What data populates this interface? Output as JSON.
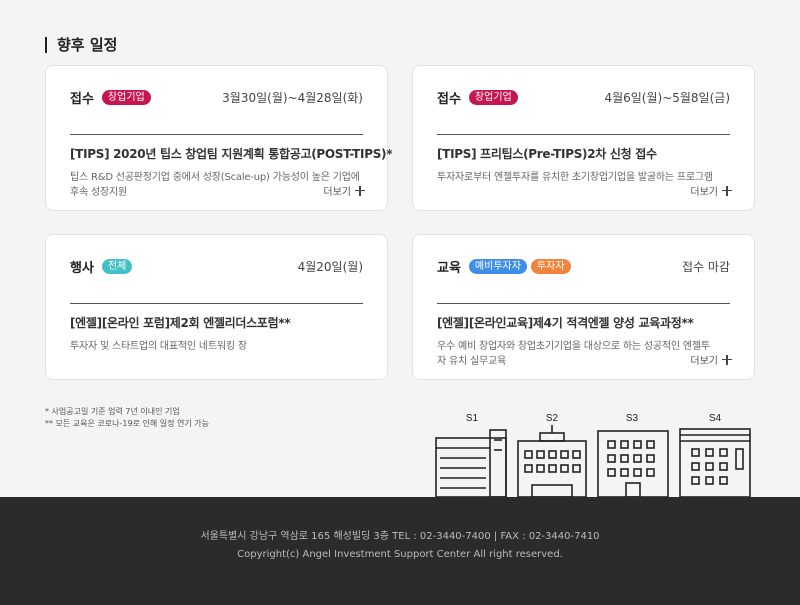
{
  "section": {
    "title": "향후 일정"
  },
  "cards": [
    {
      "category": "접수",
      "badges": [
        {
          "label": "창업기업",
          "color": "#c6164f"
        }
      ],
      "date": "3월30일(월)~4월28일(화)",
      "title": "[TIPS] 2020년 팁스 창업팀 지원계획 통합공고(POST-TIPS)*",
      "desc": "팁스 R&D 선공판정기업 중에서 성장(Scale-up) 가능성이 높은 기업에 후속 성장지원",
      "more": "더보기"
    },
    {
      "category": "접수",
      "badges": [
        {
          "label": "창업기업",
          "color": "#c6164f"
        }
      ],
      "date": "4월6일(월)~5월8일(금)",
      "title": "[TIPS] 프리팁스(Pre-TIPS)2차 신청 접수",
      "desc": "투자자로부터 엔젤투자를 유치한 초기창업기업을 발굴하는 프로그램",
      "more": "더보기"
    },
    {
      "category": "행사",
      "badges": [
        {
          "label": "전체",
          "color": "#42c0c8"
        }
      ],
      "date": "4월20일(월)",
      "title": "[엔젤][온라인 포럼]제2회 엔젤리더스포럼**",
      "desc": "투자자 및 스타트업의 대표적인 네트워킹 장",
      "more": ""
    },
    {
      "category": "교육",
      "badges": [
        {
          "label": "예비투자자",
          "color": "#3f8fe6"
        },
        {
          "label": "투자자",
          "color": "#f1833d"
        }
      ],
      "date": "접수 마감",
      "title": "[엔젤][온라인교육]제4기 적격엔젤 양성 교육과정**",
      "desc": "우수 예비 창업자와 창업초기기업을 대상으로 하는 성공적인 엔젤투자 유치 실무교육",
      "more": "더보기"
    }
  ],
  "notes": {
    "line1": "* 사업공고일 기준 업력 7년 이내인 기업",
    "line2": "** 모든 교육은 코로나-19로 인해 일정 연기 가능"
  },
  "buildings": {
    "labels": [
      "S1",
      "S2",
      "S3",
      "S4"
    ]
  },
  "footer": {
    "address": "서울특별시 강남구 역삼로 165 해성빌딩 3층 TEL : 02-3440-7400 | FAX : 02-3440-7410",
    "copyright": "Copyright(c) Angel Investment Support Center All right reserved."
  }
}
